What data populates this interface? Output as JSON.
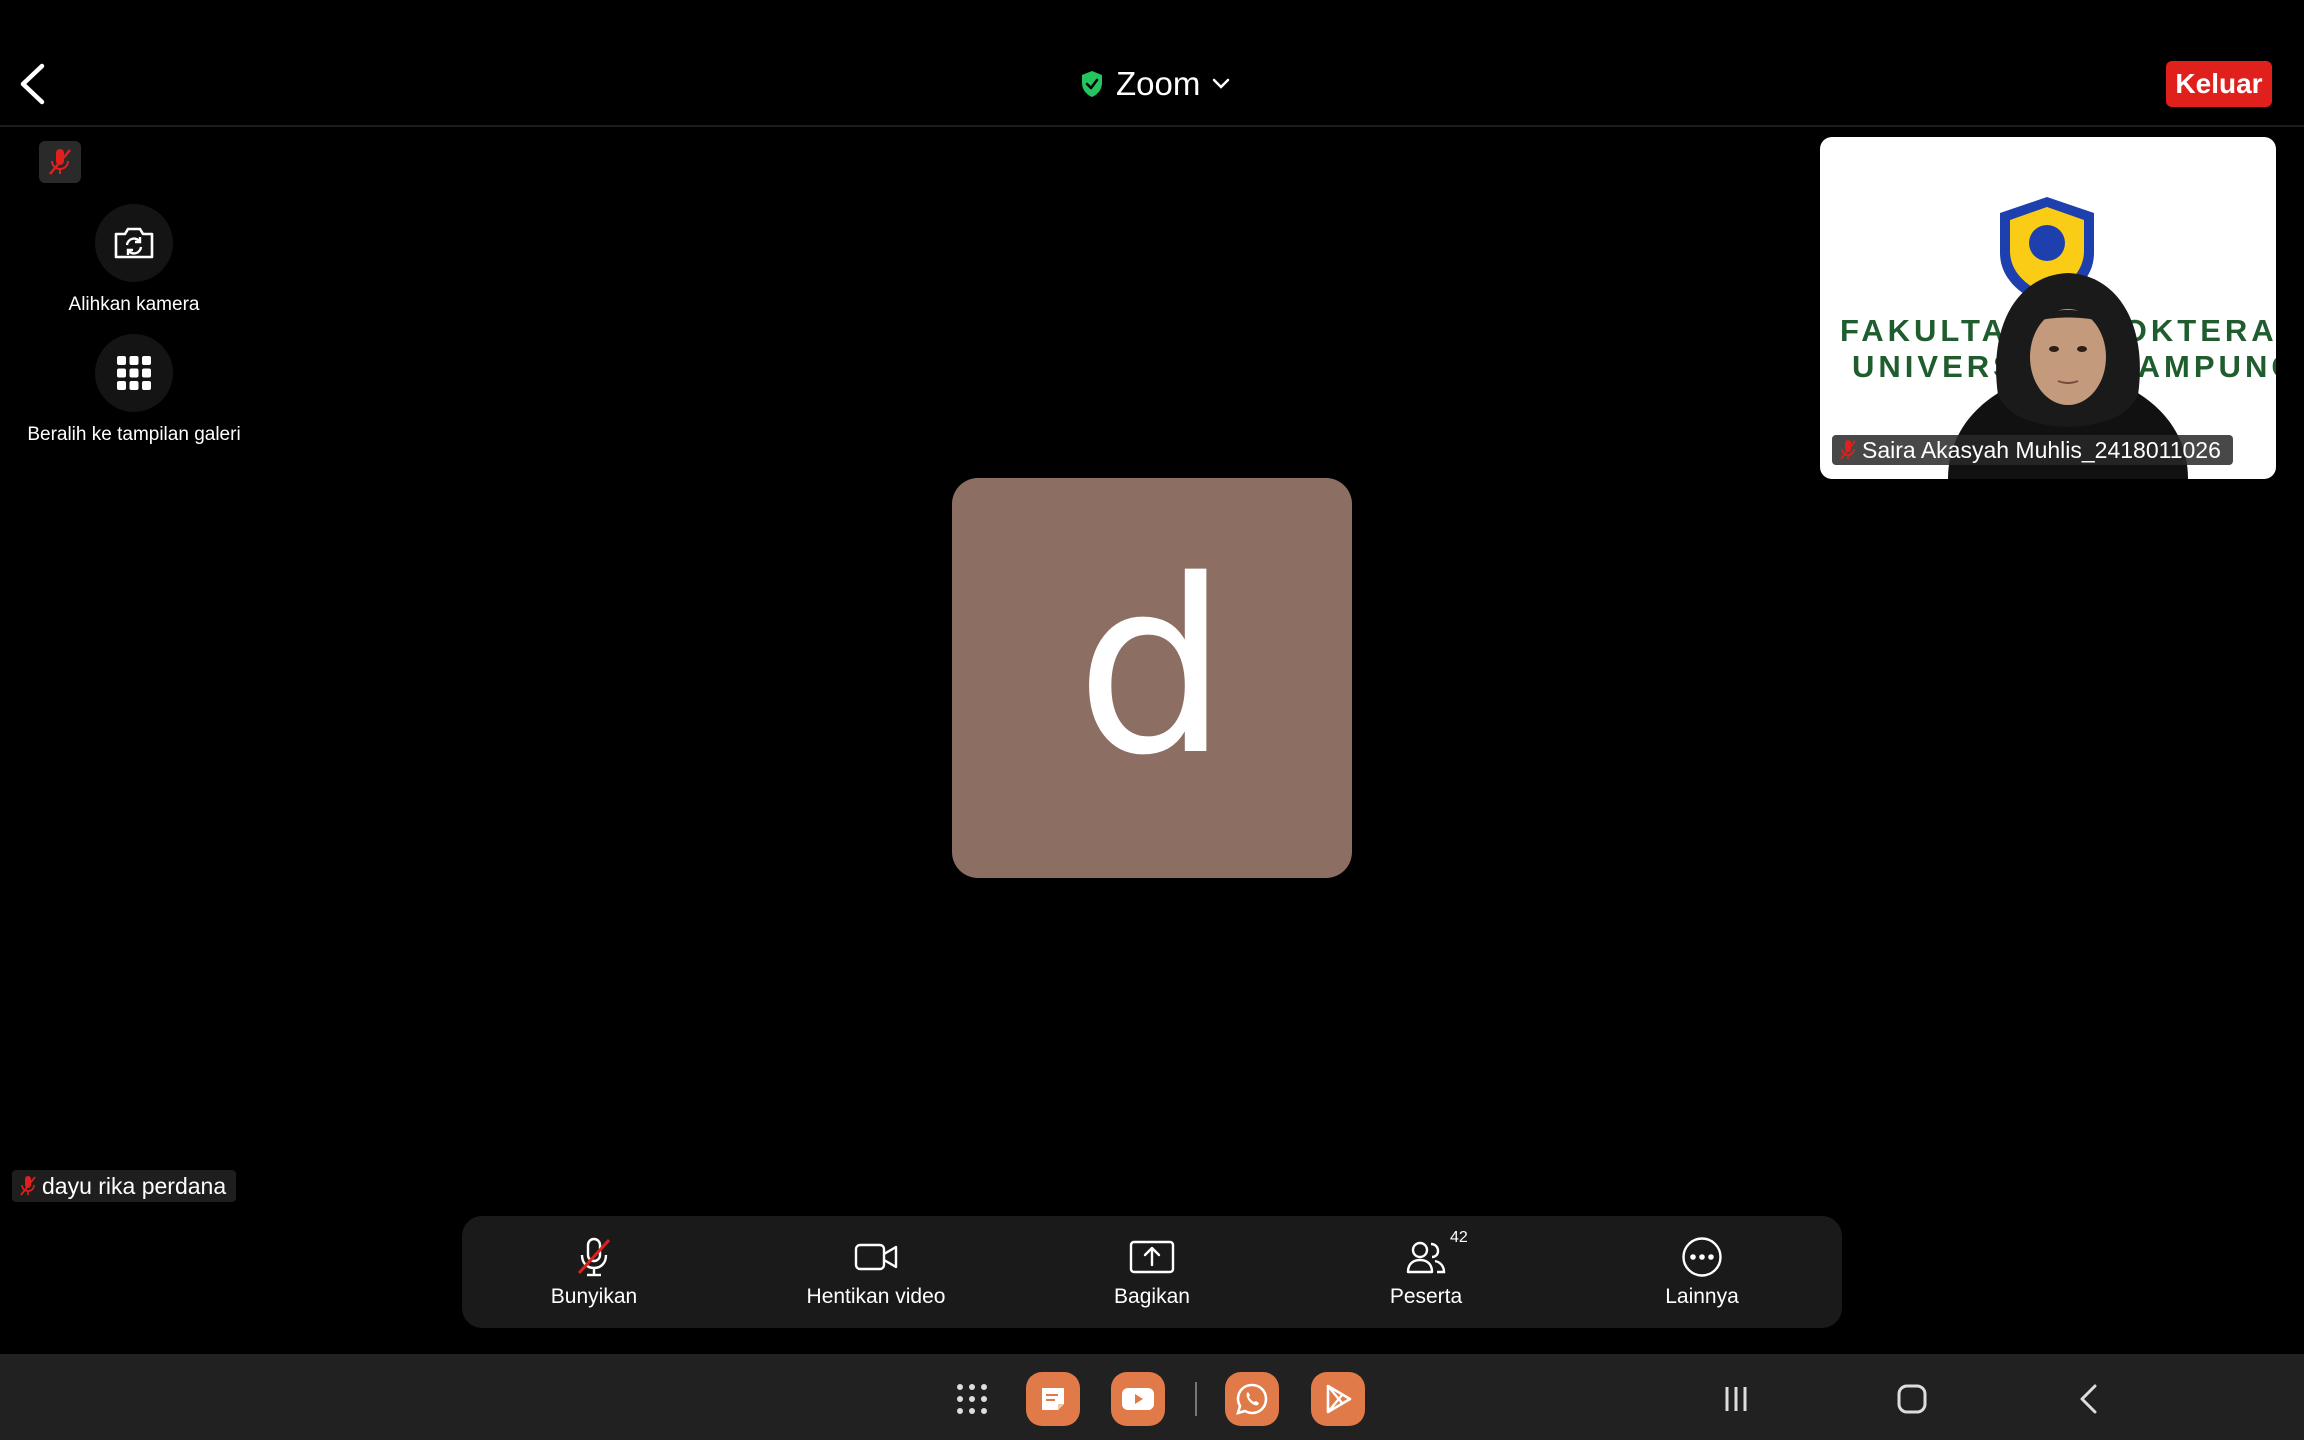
{
  "header": {
    "title": "Zoom",
    "leave_label": "Keluar"
  },
  "side_controls": {
    "switch_camera_label": "Alihkan kamera",
    "gallery_view_label": "Beralih ke tampilan galeri"
  },
  "main_video": {
    "avatar_letter": "d",
    "avatar_color": "#8d6e63",
    "participant_name": "dayu rika perdana"
  },
  "pip_video": {
    "banner_line1": "FAKULTAS KEDOKTERAN",
    "banner_line2": "UNIVERSITAS LAMPUNG",
    "participant_name": "Saira Akasyah Muhlis_2418011026"
  },
  "toolbar": {
    "unmute_label": "Bunyikan",
    "stop_video_label": "Hentikan video",
    "share_label": "Bagikan",
    "participants_label": "Peserta",
    "participants_count": "42",
    "more_label": "Lainnya"
  },
  "colors": {
    "leave_button": "#e0201c",
    "shield_green": "#22c55e",
    "muted_red": "#e0201c",
    "app_icon_orange": "#e07a48"
  },
  "system_nav": {
    "apps": [
      "app-drawer-icon",
      "notes-icon",
      "youtube-icon",
      "whatsapp-icon",
      "play-store-icon"
    ],
    "buttons": [
      "recents-icon",
      "home-icon",
      "back-icon"
    ]
  }
}
